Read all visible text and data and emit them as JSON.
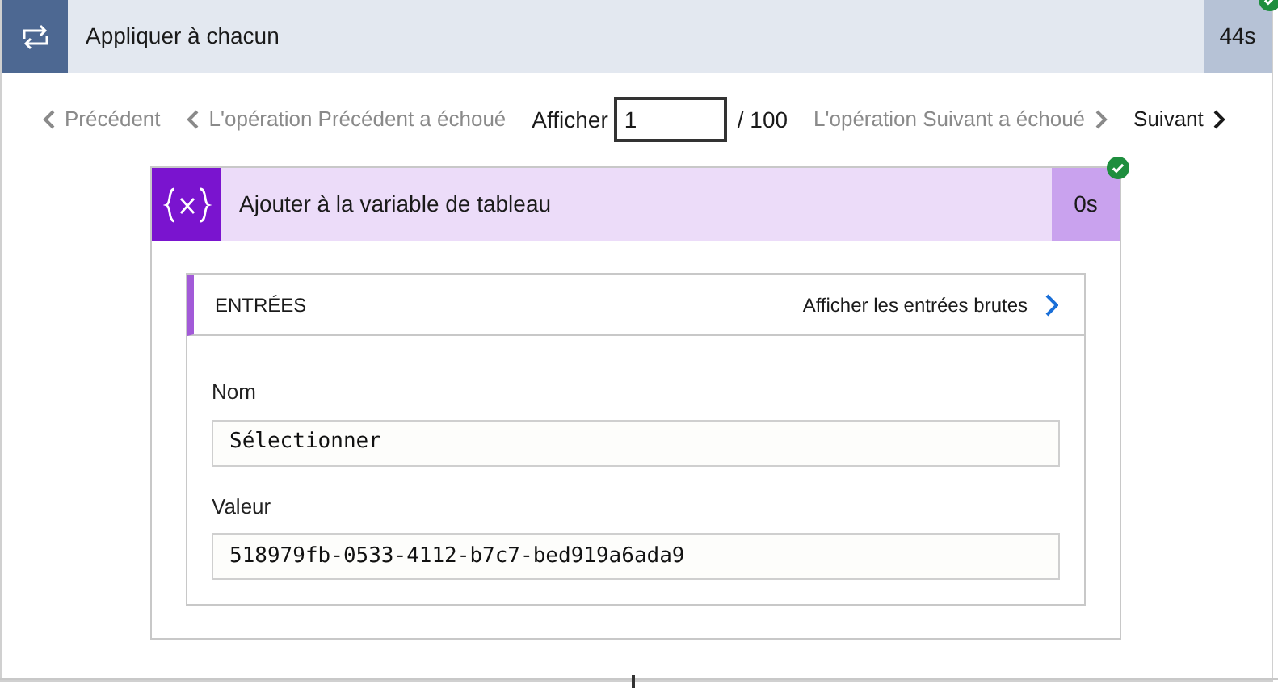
{
  "loop": {
    "title": "Appliquer à chacun",
    "duration": "44s",
    "succeeded": true
  },
  "pager": {
    "items": [
      {
        "label": "Précédent",
        "kind": "prev",
        "disabled": true
      },
      {
        "label": "L'opération Précédent a échoué",
        "kind": "prev",
        "disabled": true
      }
    ],
    "show_label": "Afficher",
    "page_value": "1",
    "total": "/ 100",
    "next_items": [
      {
        "label": "L'opération Suivant a échoué",
        "kind": "next",
        "disabled": true
      },
      {
        "label": "Suivant",
        "kind": "next",
        "disabled": false
      }
    ]
  },
  "action": {
    "title": "Ajouter à la variable de tableau",
    "duration": "0s",
    "succeeded": true,
    "inputs": {
      "heading": "ENTRÉES",
      "raw_link": "Afficher les entrées brutes",
      "fields": [
        {
          "label": "Nom",
          "value": "Sélectionner"
        },
        {
          "label": "Valeur",
          "value": "518979fb-0533-4112-b7c7-bed919a6ada9"
        }
      ]
    }
  }
}
